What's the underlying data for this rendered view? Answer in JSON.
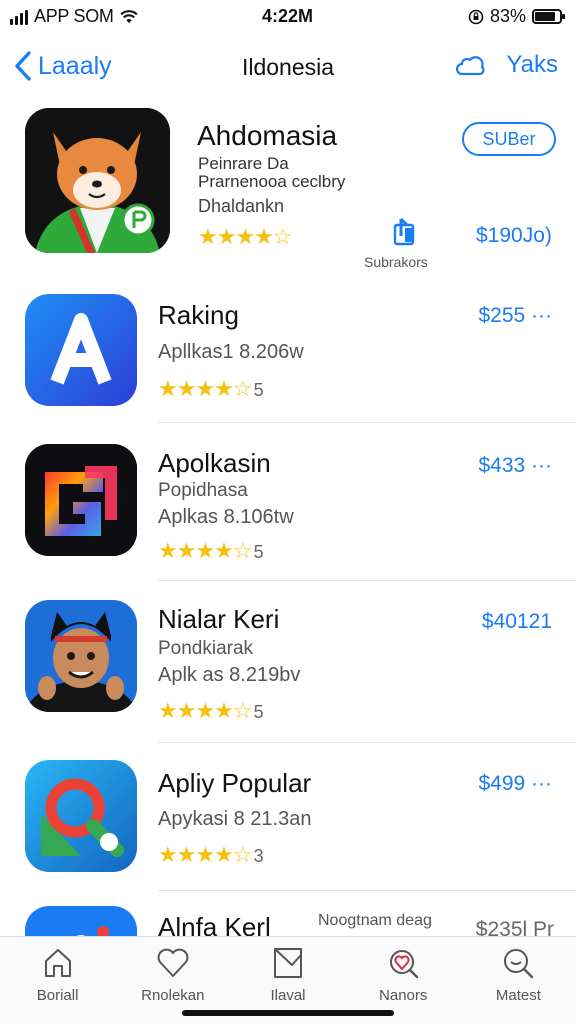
{
  "status": {
    "carrier": "APP SOM",
    "time": "4:22M",
    "battery": "83%",
    "battery_level": 0.83
  },
  "nav": {
    "back_label": "Laaaly",
    "title": "Ildonesia",
    "right_label": "Yaks",
    "accent": "#1a7cf5"
  },
  "featured": {
    "name": "Ahdomasia",
    "subtitle1": "Peinrare Da",
    "subtitle2": "Prarnenooa ceclbry",
    "developer": "Dhaldankn",
    "stars": "★★★★☆",
    "rating": 4,
    "button": "SUBer",
    "share_label": "Subrakors",
    "price": "$190Jo)"
  },
  "apps": [
    {
      "name": "Raking",
      "sub": "Apllkas1 8.206w",
      "extra": "",
      "stars": "★★★★☆",
      "count": "5",
      "rating": 4,
      "price": "$255 ···",
      "icon": "letter-a-icon"
    },
    {
      "name": "Apolkasin",
      "sub": "Aplkas 8.106tw",
      "extra": "Popidhasa",
      "stars": "★★★★☆",
      "count": "5",
      "rating": 4,
      "price": "$433 ···",
      "icon": "gradient-glyph-icon"
    },
    {
      "name": "Nialar Keri",
      "sub": "Aplk as 8.219bv",
      "extra": "Pondkiarak",
      "stars": "★★★★☆",
      "count": "5",
      "rating": 4,
      "price": "$40121",
      "icon": "character-icon"
    },
    {
      "name": "Apliy Popular",
      "sub": "Apykasi 8 21.3an",
      "extra": "",
      "stars": "★★★★☆",
      "count": "3",
      "rating": 4,
      "price": "$499 ···",
      "icon": "magnifier-app-icon"
    },
    {
      "name": "Alnfa Kerl",
      "sub": "",
      "extra": "Noogtnam deag",
      "stars": "",
      "count": "",
      "rating": 0,
      "price": "$235l Pr",
      "icon": "partial-app-icon"
    }
  ],
  "tabs": [
    {
      "label": "Boriall",
      "icon": "house-icon"
    },
    {
      "label": "Rnolekan",
      "icon": "heart-icon"
    },
    {
      "label": "Ilaval",
      "icon": "tray-icon"
    },
    {
      "label": "Nanors",
      "icon": "heart-search-icon"
    },
    {
      "label": "Matest",
      "icon": "search-icon"
    }
  ]
}
